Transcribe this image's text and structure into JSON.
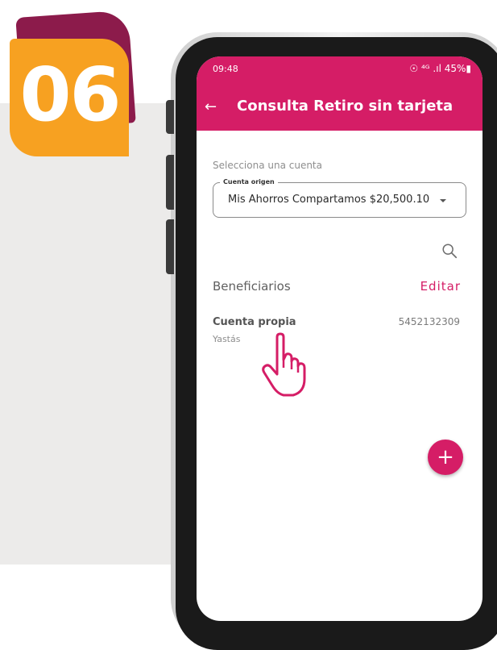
{
  "step_badge": {
    "number": "06"
  },
  "status_bar": {
    "time": "09:48",
    "indicators": "☉ ⁴ᴳ .ıl 45%▮"
  },
  "app_bar": {
    "back_icon": "arrow-left-icon",
    "title": "Consulta Retiro sin tarjeta"
  },
  "account_section": {
    "label": "Selecciona una cuenta",
    "field_label": "Cuenta origen",
    "selected_value": "Mis Ahorros Compartamos $20,500.10"
  },
  "beneficiaries": {
    "title": "Beneficiarios",
    "edit_label": "Editar",
    "items": [
      {
        "name": "Cuenta propia",
        "sub": "Yastás",
        "number": "5452132309"
      }
    ]
  },
  "fab": {
    "label": "+"
  },
  "colors": {
    "primary": "#d51d66",
    "badge": "#f7a121",
    "badge_shadow": "#8c1b4b"
  }
}
